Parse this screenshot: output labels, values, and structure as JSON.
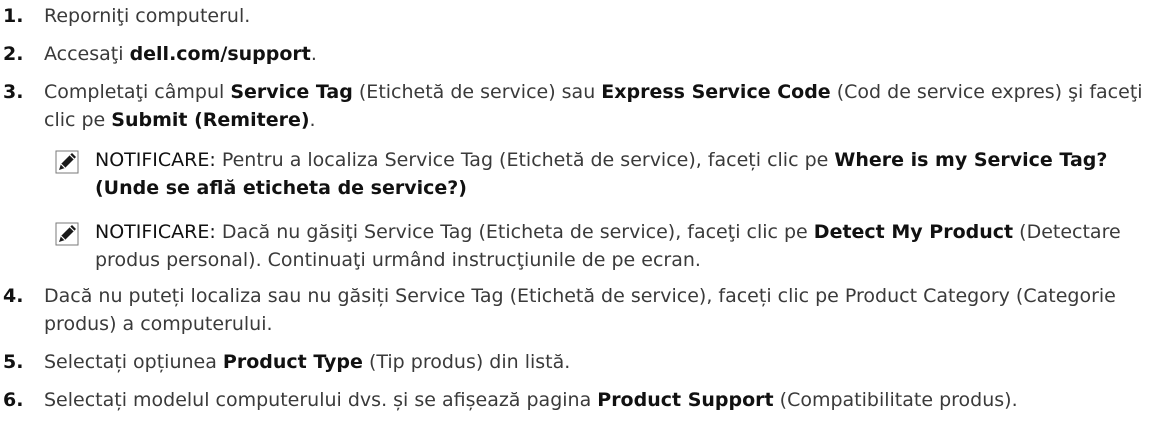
{
  "steps": [
    {
      "num": "1.",
      "t1": "Reporniţi computerul."
    },
    {
      "num": "2.",
      "t1": "Accesaţi ",
      "b1": "dell.com/support",
      "t2": "."
    },
    {
      "num": "3.",
      "t1": "Completaţi câmpul ",
      "b1": "Service Tag",
      "t2": " (Etichetă de service) sau ",
      "b2": "Express Service Code",
      "t3": " (Cod de service expres) şi faceţi clic pe ",
      "b3": "Submit (Remitere)",
      "t4": "."
    },
    {
      "num": "4.",
      "t1": "Dacă nu puteți localiza sau nu găsiți Service Tag (Etichetă de service), faceți clic pe Product Category (Categorie produs) a computerului."
    },
    {
      "num": "5.",
      "t1": "Selectați opțiunea ",
      "b1": "Product Type",
      "t2": " (Tip produs) din listă."
    },
    {
      "num": "6.",
      "t1": "Selectați modelul computerului dvs. și se afișează pagina ",
      "b1": "Product Support",
      "t2": " (Compatibilitate produs)."
    }
  ],
  "notes": [
    {
      "label": "NOTIFICARE:",
      "t1": " Pentru a localiza Service Tag (Etichetă de service), faceți clic pe ",
      "b1": "Where is my Service Tag? (Unde se află eticheta de service?)",
      "t2": ""
    },
    {
      "label": "NOTIFICARE:",
      "t1": " Dacă nu găsiţi Service Tag (Eticheta de service), faceţi clic pe ",
      "b1": "Detect My Product",
      "t2": " (Detectare produs personal). Continuaţi urmând instrucţiunile de pe ecran."
    }
  ],
  "icons": {
    "note": "pencil-note-icon"
  }
}
